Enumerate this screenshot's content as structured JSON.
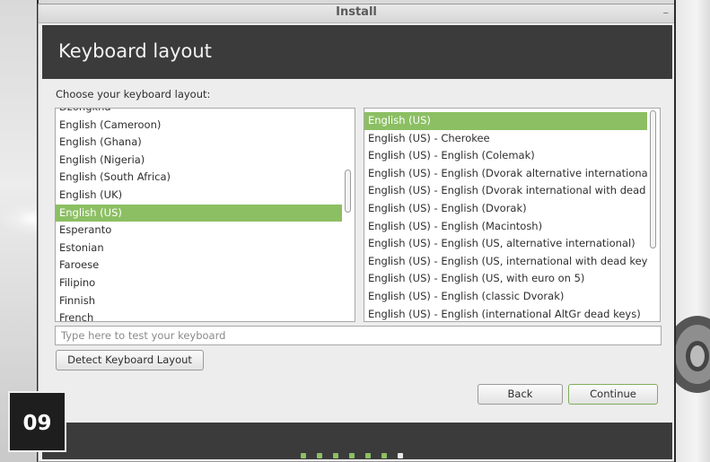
{
  "window": {
    "title": "Install",
    "minimize_glyph": "–"
  },
  "header": {
    "heading": "Keyboard layout"
  },
  "prompt": "Choose your keyboard layout:",
  "layouts": [
    "Dzongkha",
    "English (Cameroon)",
    "English (Ghana)",
    "English (Nigeria)",
    "English (South Africa)",
    "English (UK)",
    "English (US)",
    "Esperanto",
    "Estonian",
    "Faroese",
    "Filipino",
    "Finnish",
    "French"
  ],
  "selected_layout": "English (US)",
  "variants": [
    "English (US)",
    "English (US) - Cherokee",
    "English (US) - English (Colemak)",
    "English (US) - English (Dvorak alternative international",
    "English (US) - English (Dvorak international with dead k",
    "English (US) - English (Dvorak)",
    "English (US) - English (Macintosh)",
    "English (US) - English (US, alternative international)",
    "English (US) - English (US, international with dead keys",
    "English (US) - English (US, with euro on 5)",
    "English (US) - English (classic Dvorak)",
    "English (US) - English (international AltGr dead keys)"
  ],
  "selected_variant": "English (US)",
  "scroll": {
    "left_list_fraction": 0.36,
    "right_list_fraction": 0.0
  },
  "test_input": {
    "value": "",
    "placeholder": "Type here to test your keyboard"
  },
  "buttons": {
    "detect": "Detect Keyboard Layout",
    "back": "Back",
    "continue": "Continue"
  },
  "progress": {
    "total_steps": 7,
    "current_step": 7
  },
  "step_badge": "09",
  "colors": {
    "accent": "#8cbf63",
    "header_band": "#3b3b3b",
    "window_bg": "#ededed",
    "badge_bg": "#1e1e1e"
  }
}
